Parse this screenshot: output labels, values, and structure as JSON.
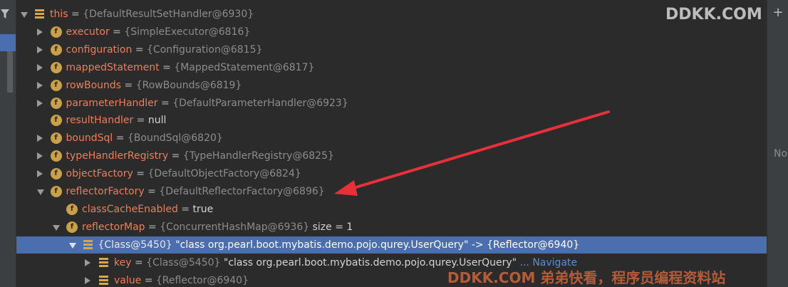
{
  "tree": {
    "rows": [
      {
        "name": "this",
        "eq": " = ",
        "ref": "{DefaultResultSetHandler@6930}",
        "lit": "",
        "icon": "list",
        "arrow": "expanded",
        "depth": 0
      },
      {
        "name": "executor",
        "eq": " = ",
        "ref": "{SimpleExecutor@6816}",
        "lit": "",
        "icon": "field",
        "arrow": "collapsed",
        "depth": 1
      },
      {
        "name": "configuration",
        "eq": " = ",
        "ref": "{Configuration@6815}",
        "lit": "",
        "icon": "field",
        "arrow": "collapsed",
        "depth": 1
      },
      {
        "name": "mappedStatement",
        "eq": " = ",
        "ref": "{MappedStatement@6817}",
        "lit": "",
        "icon": "field",
        "arrow": "collapsed",
        "depth": 1
      },
      {
        "name": "rowBounds",
        "eq": " = ",
        "ref": "{RowBounds@6819}",
        "lit": "",
        "icon": "field",
        "arrow": "collapsed",
        "depth": 1
      },
      {
        "name": "parameterHandler",
        "eq": " = ",
        "ref": "{DefaultParameterHandler@6923}",
        "lit": "",
        "icon": "field",
        "arrow": "collapsed",
        "depth": 1
      },
      {
        "name": "resultHandler",
        "eq": " = ",
        "ref": "",
        "lit": "null",
        "icon": "field",
        "arrow": "none",
        "depth": 1
      },
      {
        "name": "boundSql",
        "eq": " = ",
        "ref": "{BoundSql@6820}",
        "lit": "",
        "icon": "field",
        "arrow": "collapsed",
        "depth": 1
      },
      {
        "name": "typeHandlerRegistry",
        "eq": " = ",
        "ref": "{TypeHandlerRegistry@6825}",
        "lit": "",
        "icon": "field",
        "arrow": "collapsed",
        "depth": 1
      },
      {
        "name": "objectFactory",
        "eq": " = ",
        "ref": "{DefaultObjectFactory@6824}",
        "lit": "",
        "icon": "field",
        "arrow": "collapsed",
        "depth": 1
      },
      {
        "name": "reflectorFactory",
        "eq": " = ",
        "ref": "{DefaultReflectorFactory@6896}",
        "lit": "",
        "icon": "field",
        "arrow": "expanded",
        "depth": 1
      },
      {
        "name": "classCacheEnabled",
        "eq": " = ",
        "ref": "",
        "lit": "true",
        "icon": "field",
        "arrow": "none",
        "depth": 2
      },
      {
        "name": "reflectorMap",
        "eq": " = ",
        "ref": "{ConcurrentHashMap@6936} ",
        "lit": " size = 1",
        "icon": "field",
        "arrow": "expanded",
        "depth": 2
      },
      {
        "name": "",
        "eq": "",
        "ref": "{Class@5450} ",
        "lit": "\"class org.pearl.boot.mybatis.demo.pojo.qurey.UserQuery\" -> {Reflector@6940}",
        "icon": "list",
        "arrow": "expanded",
        "depth": 3,
        "selected": true
      },
      {
        "name": "key",
        "eq": " = ",
        "ref": "{Class@5450} ",
        "lit": "\"class org.pearl.boot.mybatis.demo.pojo.qurey.UserQuery\"",
        "icon": "list",
        "arrow": "collapsed",
        "depth": 4,
        "nav": " ... Navigate"
      },
      {
        "name": "value",
        "eq": " = ",
        "ref": "{Reflector@6940}",
        "lit": "",
        "icon": "list",
        "arrow": "collapsed",
        "depth": 4
      }
    ]
  },
  "gutter": {
    "plus": "+",
    "side_text": "No"
  },
  "watermarks": {
    "top": "DDKK.COM",
    "bottom": "DDKK.COM 弟弟快看，程序员编程资料站"
  },
  "icons": {
    "field": "f",
    "filter": "filter-icon",
    "list": "list-icon"
  },
  "colors": {
    "background": "#2b2b2b",
    "selection": "#4b6eaf",
    "var_name": "#ee7e59",
    "reference": "#8c8c8c",
    "annotation_arrow": "#e8303a",
    "navigate": "#5b8ed6"
  }
}
